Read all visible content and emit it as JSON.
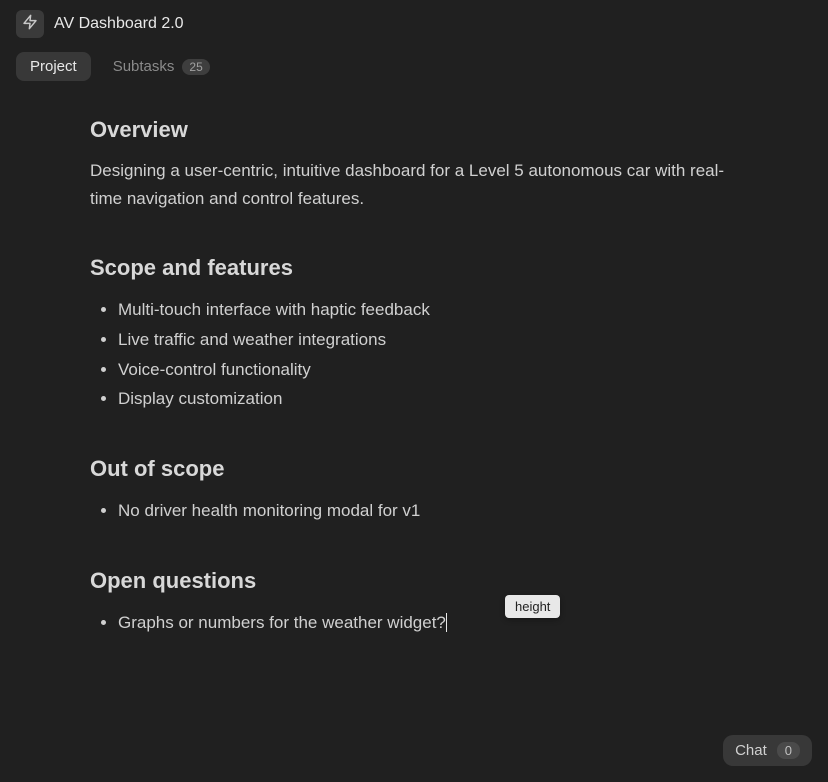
{
  "header": {
    "title": "AV Dashboard 2.0"
  },
  "tabs": {
    "project": "Project",
    "subtasks": "Subtasks",
    "subtasks_count": "25"
  },
  "sections": {
    "overview": {
      "heading": "Overview",
      "body": "Designing a user-centric, intuitive dashboard for a Level 5 autonomous car with real-time navigation and control features."
    },
    "scope": {
      "heading": "Scope and features",
      "items": [
        "Multi-touch interface with haptic feedback",
        "Live traffic and weather integrations",
        "Voice-control functionality",
        "Display customization"
      ]
    },
    "out_of_scope": {
      "heading": "Out of scope",
      "items": [
        "No driver health monitoring modal for v1"
      ]
    },
    "open_questions": {
      "heading": "Open questions",
      "items": [
        "Graphs or numbers for the weather widget?"
      ]
    }
  },
  "tooltip": "height",
  "chat": {
    "label": "Chat",
    "count": "0"
  }
}
